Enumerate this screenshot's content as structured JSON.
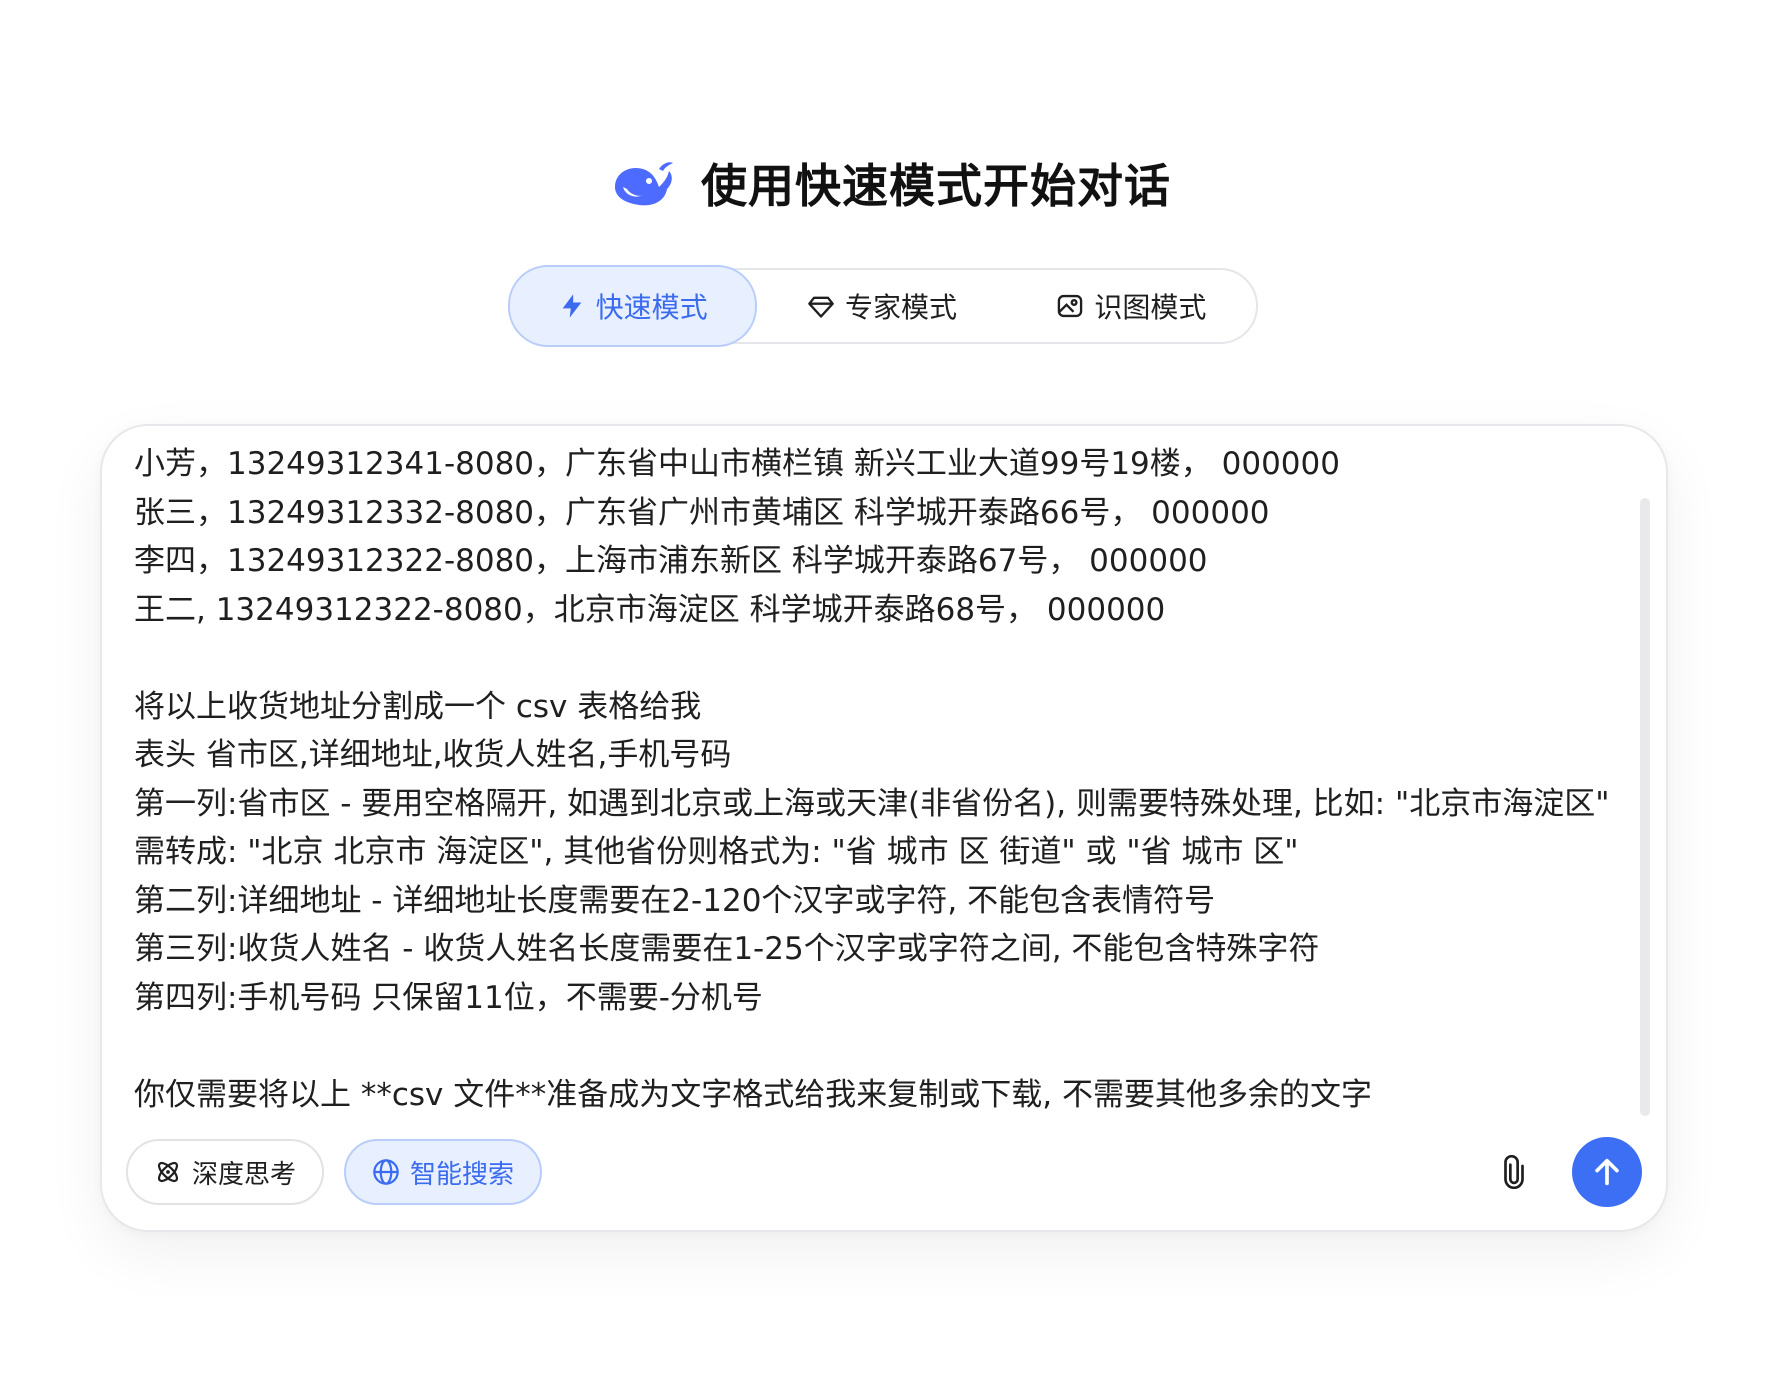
{
  "header": {
    "title": "使用快速模式开始对话",
    "logo_icon": "whale-logo-icon",
    "brand_color": "#4d6bfe"
  },
  "modes": {
    "items": [
      {
        "label": "快速模式",
        "icon": "lightning-icon",
        "active": true
      },
      {
        "label": "专家模式",
        "icon": "diamond-icon",
        "active": false
      },
      {
        "label": "识图模式",
        "icon": "image-icon",
        "active": false
      }
    ],
    "active_color": "#3b6cf0"
  },
  "composer": {
    "message": "小芳，13249312341-8080，广东省中山市横栏镇 新兴工业大道99号19楼， 000000\n张三，13249312332-8080，广东省广州市黄埔区 科学城开泰路66号， 000000\n李四，13249312322-8080，上海市浦东新区 科学城开泰路67号， 000000\n王二, 13249312322-8080，北京市海淀区 科学城开泰路68号， 000000\n\n将以上收货地址分割成一个 csv 表格给我\n表头 省市区,详细地址,收货人姓名,手机号码\n第一列:省市区 - 要用空格隔开, 如遇到北京或上海或天津(非省份名), 则需要特殊处理, 比如: \"北京市海淀区\" 需转成: \"北京 北京市 海淀区\", 其他省份则格式为: \"省 城市 区 街道\" 或 \"省 城市 区\"\n第二列:详细地址 - 详细地址长度需要在2-120个汉字或字符, 不能包含表情符号\n第三列:收货人姓名 - 收货人姓名长度需要在1-25个汉字或字符之间, 不能包含特殊字符\n第四列:手机号码 只保留11位，不需要-分机号\n\n你仅需要将以上 **csv 文件**准备成为文字格式给我来复制或下载, 不需要其他多余的文字",
    "deep_think_label": "深度思考",
    "deep_think_icon": "atom-icon",
    "smart_search_label": "智能搜索",
    "smart_search_icon": "globe-icon",
    "attach_icon": "paperclip-icon",
    "send_icon": "arrow-up-icon",
    "send_color": "#3d6ff5"
  }
}
